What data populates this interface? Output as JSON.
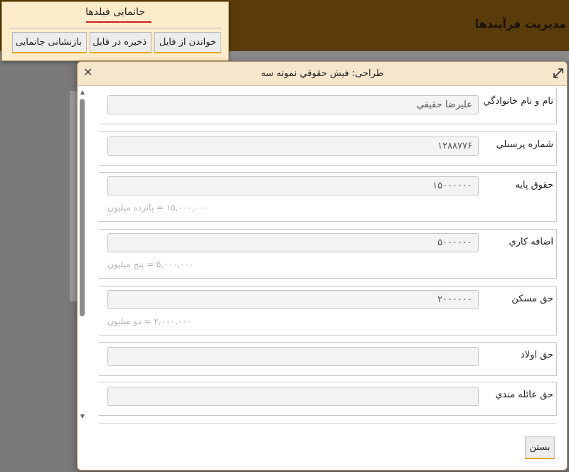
{
  "app": {
    "header_title": "مديريت فرآيندها"
  },
  "field_panel": {
    "title": "جانمایی فیلدها",
    "buttons": [
      {
        "label": "خواندن از فایل"
      },
      {
        "label": "ذخیره در فایل"
      },
      {
        "label": "بازنشانی جانمایی"
      }
    ]
  },
  "dialog": {
    "title": "طراحی: فيش حقوقي نمونه سه",
    "close_icon": "close-icon",
    "expand_icon": "expand-icon",
    "fields": [
      {
        "label": "نام و نام خانوادگي",
        "value": "عليرضا حقيقي",
        "help": ""
      },
      {
        "label": "شماره پرسنلي",
        "value": "۱۲۸۸۷۷۶",
        "help": ""
      },
      {
        "label": "حقوق پايه",
        "value": "۱۵۰۰۰۰۰۰",
        "help": "۱۵,۰۰۰,۰۰۰ = پانزده میلیون"
      },
      {
        "label": "اضافه کاري",
        "value": "۵۰۰۰۰۰۰",
        "help": "۵,۰۰۰,۰۰۰ = پنج میلیون"
      },
      {
        "label": "حق مسکن",
        "value": "۲۰۰۰۰۰۰",
        "help": "۲,۰۰۰,۰۰۰ = دو میلیون"
      },
      {
        "label": "حق اولاد",
        "value": "",
        "help": ""
      },
      {
        "label": "حق عائله مندي",
        "value": "",
        "help": ""
      }
    ],
    "close_button": "بستن"
  },
  "colors": {
    "accent": "#e5a600",
    "header_bg": "#f6e6cc",
    "panel_bg": "#fdeccb",
    "app_header": "#5a3b0a"
  }
}
